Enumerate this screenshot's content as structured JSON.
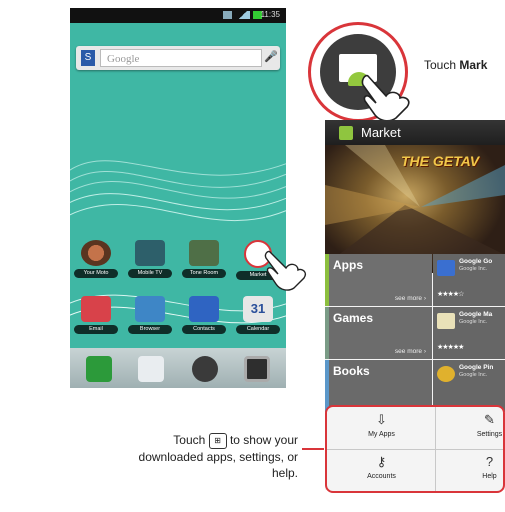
{
  "status_bar": {
    "time": "11:35"
  },
  "home": {
    "search_placeholder": "Google",
    "search_logo": "S",
    "apps_row1": [
      {
        "label": "Your Moto",
        "color": "#7a4a2a",
        "icon": "compass-icon"
      },
      {
        "label": "Mobile TV",
        "color": "#2d5f6a",
        "icon": "tv-icon"
      },
      {
        "label": "Tone Room",
        "color": "#4f6f47",
        "icon": "music-icon"
      },
      {
        "label": "Market",
        "color": "#3d3d3d",
        "icon": "market-icon"
      }
    ],
    "apps_row2": [
      {
        "label": "Email",
        "color": "#d8424a",
        "icon": "email-icon"
      },
      {
        "label": "Browser",
        "color": "#3e86c6",
        "icon": "globe-icon"
      },
      {
        "label": "Contacts",
        "color": "#2f64c2",
        "icon": "contacts-icon"
      },
      {
        "label": "Calendar",
        "color": "#e7e7e7",
        "icon": "calendar-icon",
        "glyph": "31"
      }
    ],
    "dock": [
      {
        "icon": "phone-icon",
        "color": "#2c9a3a"
      },
      {
        "icon": "messaging-icon",
        "color": "#e9edf0"
      },
      {
        "icon": "camera-icon",
        "color": "#3a3a3a"
      },
      {
        "icon": "app-tray-icon",
        "color": "#2e2e2e"
      }
    ]
  },
  "zoom_label": {
    "prefix": "Touch ",
    "bold": "Mark"
  },
  "market": {
    "title": "Market",
    "banner_headline": "THE GETAV",
    "categories": [
      {
        "name": "Apps",
        "more": "see more ›",
        "color": "#8cbf3e"
      },
      {
        "name": "Games",
        "more": "see more ›",
        "color": "#7a9b86"
      },
      {
        "name": "Books",
        "more": "",
        "color": "#5b97c9"
      }
    ],
    "featured": [
      {
        "title": "Google Go",
        "subtitle": "Google Inc.",
        "stars": "★★★★☆",
        "icon": "goggles-icon",
        "color": "#3a6fd0"
      },
      {
        "title": "Google Ma",
        "subtitle": "Google Inc.",
        "stars": "★★★★★",
        "icon": "maps-icon",
        "color": "#e9e1b8"
      },
      {
        "title": "Google Pin",
        "subtitle": "Google Inc.",
        "stars": "",
        "icon": "pinwheel-icon",
        "color": "#e0b12d"
      }
    ],
    "menu": [
      {
        "label": "My Apps",
        "glyph": "⇩",
        "icon": "download-icon"
      },
      {
        "label": "Settings",
        "glyph": "✎",
        "icon": "wrench-icon"
      },
      {
        "label": "Accounts",
        "glyph": "⚷",
        "icon": "key-icon"
      },
      {
        "label": "Help",
        "glyph": "?",
        "icon": "help-icon"
      }
    ]
  },
  "callout": {
    "before_key": "Touch ",
    "key_glyph": "⊞",
    "after_key": " to show your",
    "line2": "downloaded apps, settings, or",
    "line3": "help."
  },
  "accent_color": "#d9353a"
}
